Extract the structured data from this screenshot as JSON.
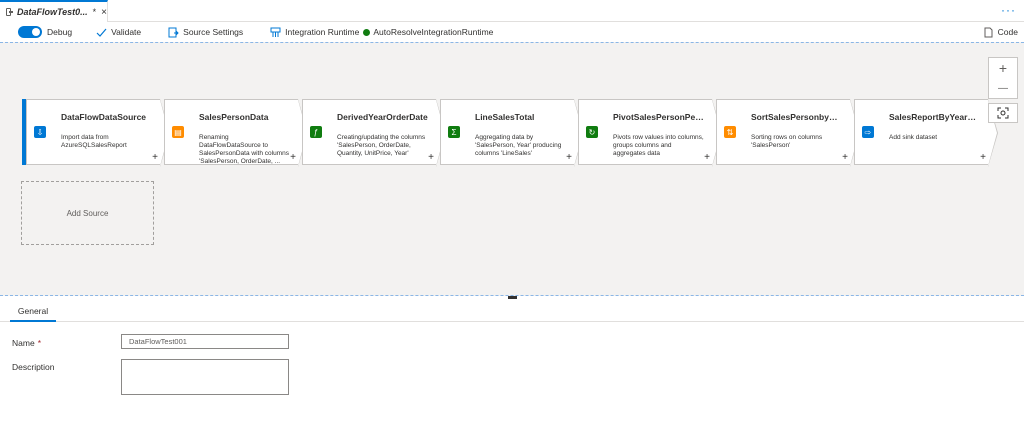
{
  "tab": {
    "title": "DataFlowTest0...",
    "dirty_marker": "*",
    "close": "×"
  },
  "toolbar": {
    "debug_label": "Debug",
    "validate_label": "Validate",
    "source_settings_label": "Source Settings",
    "integration_runtime_label": "Integration Runtime",
    "runtime_name": "AutoResolveIntegrationRuntime",
    "code_label": "Code",
    "debug_enabled": true
  },
  "flow": {
    "nodes": [
      {
        "title": "DataFlowDataSource",
        "description": "Import data from AzureSQLSalesReport",
        "icon": "source-icon",
        "color": "#0078d4"
      },
      {
        "title": "SalesPersonData",
        "description": "Renaming DataFlowDataSource to SalesPersonData with columns 'SalesPerson, OrderDate, ...",
        "icon": "select-icon",
        "color": "#ff8c00"
      },
      {
        "title": "DerivedYearOrderDate",
        "description": "Creating/updating the columns 'SalesPerson, OrderDate, Quantity, UnitPrice, Year'",
        "icon": "derived-column-icon",
        "color": "#107c10"
      },
      {
        "title": "LineSalesTotal",
        "description": "Aggregating data by 'SalesPerson, Year' producing columns 'LineSales'",
        "icon": "aggregate-icon",
        "color": "#107c10"
      },
      {
        "title": "PivotSalesPersonPerYear",
        "description": "Pivots row values into columns, groups columns and aggregates data",
        "icon": "pivot-icon",
        "color": "#107c10"
      },
      {
        "title": "SortSalesPersonbyNam...",
        "description": "Sorting rows on columns 'SalesPerson'",
        "icon": "sort-icon",
        "color": "#ff8c00"
      },
      {
        "title": "SalesReportByYearCSV",
        "description": "Add sink dataset",
        "icon": "sink-icon",
        "color": "#0078d4"
      }
    ],
    "add_source_label": "Add Source",
    "add_symbol": "+"
  },
  "zoom": {
    "zoom_in": "+",
    "zoom_out": "—"
  },
  "properties": {
    "tab_general": "General",
    "name_label": "Name",
    "name_required": "*",
    "name_value": "DataFlowTest001",
    "description_label": "Description",
    "description_value": ""
  }
}
